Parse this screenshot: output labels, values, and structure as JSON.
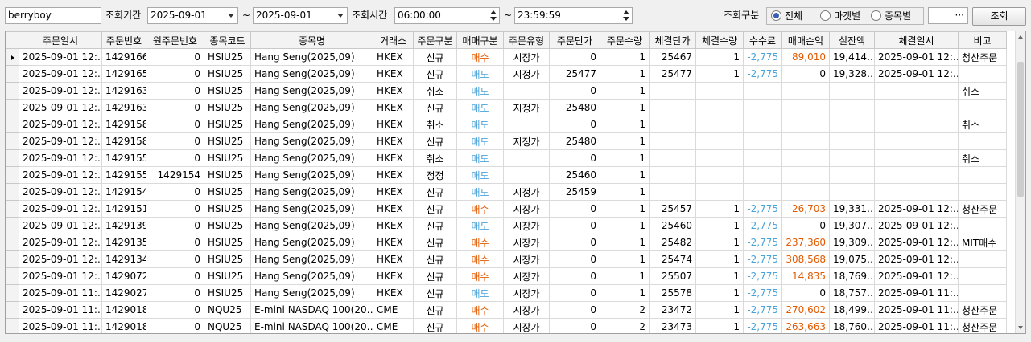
{
  "toolbar": {
    "account": "berryboy",
    "period_label": "조회기간",
    "date_from": "2025-09-01",
    "tilde": "~",
    "date_to": "2025-09-01",
    "time_label": "조회시간",
    "time_from": "06:00:00",
    "time_to": "23:59:59",
    "kind_label": "조회구분",
    "kind_options": [
      "전체",
      "마켓별",
      "종목별"
    ],
    "kind_selected": "전체",
    "ellipsis": "···",
    "search_label": "조회"
  },
  "columns": [
    "주문일시",
    "주문번호",
    "원주문번호",
    "종목코드",
    "종목명",
    "거래소",
    "주문구분",
    "매매구분",
    "주문유형",
    "주문단가",
    "주문수량",
    "체결단가",
    "체결수량",
    "수수료",
    "매매손익",
    "실잔액",
    "체결일시",
    "비고"
  ],
  "rows": [
    [
      "2025-09-01 12:…",
      "1429166",
      "0",
      "HSIU25",
      "Hang Seng(2025,09)",
      "HKEX",
      "신규",
      "매수",
      "시장가",
      "0",
      "1",
      "25467",
      "1",
      "-2,775",
      "89,010",
      "19,414…",
      "2025-09-01 12:…",
      "청산주문"
    ],
    [
      "2025-09-01 12:…",
      "1429165",
      "0",
      "HSIU25",
      "Hang Seng(2025,09)",
      "HKEX",
      "신규",
      "매도",
      "지정가",
      "25477",
      "1",
      "25477",
      "1",
      "-2,775",
      "0",
      "19,328…",
      "2025-09-01 12:…",
      ""
    ],
    [
      "2025-09-01 12:…",
      "1429163",
      "0",
      "HSIU25",
      "Hang Seng(2025,09)",
      "HKEX",
      "취소",
      "매도",
      "",
      "0",
      "1",
      "",
      "",
      "",
      "",
      "",
      "",
      "취소"
    ],
    [
      "2025-09-01 12:…",
      "1429163",
      "0",
      "HSIU25",
      "Hang Seng(2025,09)",
      "HKEX",
      "신규",
      "매도",
      "지정가",
      "25480",
      "1",
      "",
      "",
      "",
      "",
      "",
      "",
      ""
    ],
    [
      "2025-09-01 12:…",
      "1429158",
      "0",
      "HSIU25",
      "Hang Seng(2025,09)",
      "HKEX",
      "취소",
      "매도",
      "",
      "0",
      "1",
      "",
      "",
      "",
      "",
      "",
      "",
      "취소"
    ],
    [
      "2025-09-01 12:…",
      "1429158",
      "0",
      "HSIU25",
      "Hang Seng(2025,09)",
      "HKEX",
      "신규",
      "매도",
      "지정가",
      "25480",
      "1",
      "",
      "",
      "",
      "",
      "",
      "",
      ""
    ],
    [
      "2025-09-01 12:…",
      "1429155",
      "0",
      "HSIU25",
      "Hang Seng(2025,09)",
      "HKEX",
      "취소",
      "매도",
      "",
      "0",
      "1",
      "",
      "",
      "",
      "",
      "",
      "",
      "취소"
    ],
    [
      "2025-09-01 12:…",
      "1429155",
      "1429154",
      "HSIU25",
      "Hang Seng(2025,09)",
      "HKEX",
      "정정",
      "매도",
      "",
      "25460",
      "1",
      "",
      "",
      "",
      "",
      "",
      "",
      ""
    ],
    [
      "2025-09-01 12:…",
      "1429154",
      "0",
      "HSIU25",
      "Hang Seng(2025,09)",
      "HKEX",
      "신규",
      "매도",
      "지정가",
      "25459",
      "1",
      "",
      "",
      "",
      "",
      "",
      "",
      ""
    ],
    [
      "2025-09-01 12:…",
      "1429151",
      "0",
      "HSIU25",
      "Hang Seng(2025,09)",
      "HKEX",
      "신규",
      "매수",
      "시장가",
      "0",
      "1",
      "25457",
      "1",
      "-2,775",
      "26,703",
      "19,331…",
      "2025-09-01 12:…",
      "청산주문"
    ],
    [
      "2025-09-01 12:…",
      "1429139",
      "0",
      "HSIU25",
      "Hang Seng(2025,09)",
      "HKEX",
      "신규",
      "매도",
      "시장가",
      "0",
      "1",
      "25460",
      "1",
      "-2,775",
      "0",
      "19,307…",
      "2025-09-01 12:…",
      ""
    ],
    [
      "2025-09-01 12:…",
      "1429135",
      "0",
      "HSIU25",
      "Hang Seng(2025,09)",
      "HKEX",
      "신규",
      "매수",
      "시장가",
      "0",
      "1",
      "25482",
      "1",
      "-2,775",
      "237,360",
      "19,309…",
      "2025-09-01 12:…",
      "MIT매수"
    ],
    [
      "2025-09-01 12:…",
      "1429134",
      "0",
      "HSIU25",
      "Hang Seng(2025,09)",
      "HKEX",
      "신규",
      "매수",
      "시장가",
      "0",
      "1",
      "25474",
      "1",
      "-2,775",
      "308,568",
      "19,075…",
      "2025-09-01 12:…",
      ""
    ],
    [
      "2025-09-01 12:…",
      "1429072",
      "0",
      "HSIU25",
      "Hang Seng(2025,09)",
      "HKEX",
      "신규",
      "매수",
      "시장가",
      "0",
      "1",
      "25507",
      "1",
      "-2,775",
      "14,835",
      "18,769…",
      "2025-09-01 12:…",
      ""
    ],
    [
      "2025-09-01 11:…",
      "1429027",
      "0",
      "HSIU25",
      "Hang Seng(2025,09)",
      "HKEX",
      "신규",
      "매도",
      "시장가",
      "0",
      "1",
      "25578",
      "1",
      "-2,775",
      "0",
      "18,757…",
      "2025-09-01 11:…",
      ""
    ],
    [
      "2025-09-01 11:…",
      "1429018",
      "0",
      "NQU25",
      "E-mini NASDAQ 100(20…",
      "CME",
      "신규",
      "매수",
      "시장가",
      "0",
      "2",
      "23472",
      "1",
      "-2,775",
      "270,602",
      "18,499…",
      "2025-09-01 11:…",
      "청산주문"
    ],
    [
      "2025-09-01 11:…",
      "1429018",
      "0",
      "NQU25",
      "E-mini NASDAQ 100(20…",
      "CME",
      "신규",
      "매수",
      "시장가",
      "0",
      "2",
      "23473",
      "1",
      "-2,775",
      "263,663",
      "18,760…",
      "2025-09-01 11:…",
      "청산주문"
    ]
  ],
  "selected_row": 0,
  "colors": {
    "buy": "#e25a00",
    "sell": "#4aa3d8",
    "fee": "#4aa3d8",
    "pnl": "#e25a00"
  }
}
